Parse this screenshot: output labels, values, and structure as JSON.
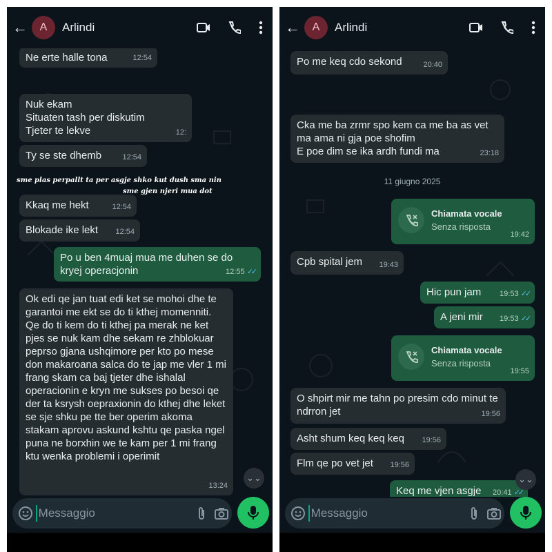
{
  "contact": {
    "initial": "A",
    "name": "Arlindi"
  },
  "composer": {
    "placeholder": "Messaggio"
  },
  "left": {
    "messages": [
      {
        "text": "Ne  erte halle tona",
        "time": "12:54"
      },
      {
        "text": "Nuk ekam\nSituaten tash per diskutim\nTjeter te lekve",
        "time": "12:"
      },
      {
        "text": "Ty se ste dhemb",
        "time": "12:54"
      },
      {
        "text": "Kkaq me hekt",
        "time": "12:54"
      },
      {
        "text": "Blokade ike lekt",
        "time": "12:54"
      },
      {
        "text": "Po u ben 4muaj mua me duhen se do kryej operacjonin",
        "time": "12:55"
      },
      {
        "text": "Ok edi qe jan tuat edi ket se mohoi dhe te garantoi me ekt se do ti kthej momenniti. Qe do ti kem do ti kthej pa merak ne ket pjes se nuk kam dhe sekam re zhblokuar peprso gjana ushqimore per kto po mese don makaroana salca do te jap me vler 1 mi frang skam ca baj tjeter dhe ishalal operacionin e kryn me sukses po besoi qe der ta ksrysh oepraxionin do kthej dhe leket se sje shku pe tte ber operim akoma stakam aprovu askund kshtu qe paska ngel puna ne borxhin we te kam per 1 mi frang ktu wenka problemi i operimit",
        "time": "13:24"
      }
    ],
    "overlay": {
      "line1": "sme plas perpallt ta per asgje shko kut dush sma nin",
      "line2": "sme gjen njeri mua dot"
    }
  },
  "right": {
    "messages": [
      {
        "text": "Po me keq cdo sekond",
        "time": "20:40"
      },
      {
        "text": "Cka me ba zrmr spo kem ca me ba as vet ma ama ni gja poe shofim\nE poe dim se ika ardh fundi ma",
        "time": "23:18"
      },
      {
        "text": "Chiamata vocale",
        "sub": "Senza risposta",
        "time": "19:42"
      },
      {
        "text": "Cpb spital jem",
        "time": "19:43"
      },
      {
        "text": "Hic pun jam",
        "time": "19:53"
      },
      {
        "text": "A jeni mir",
        "time": "19:53"
      },
      {
        "text": "Chiamata vocale",
        "sub": "Senza risposta",
        "time": "19:55"
      },
      {
        "text": "O shpirt mir me tahn po presim cdo minut te ndrron jet",
        "time": "19:56"
      },
      {
        "text": "Asht shum keq keq keq",
        "time": "19:56"
      },
      {
        "text": "Flm qe po vet jet",
        "time": "19:56"
      },
      {
        "text": "Keq me vjen asgje",
        "time": "20:41"
      }
    ],
    "date": "11 giugno 2025"
  },
  "icons": {
    "back": "arrow-left-icon",
    "video": "video-camera-icon",
    "call": "phone-icon",
    "menu": "more-vertical-icon",
    "emoji": "sticker-icon",
    "attach": "paperclip-icon",
    "camera": "camera-icon",
    "mic": "microphone-icon",
    "scroll": "chevron-double-down-icon",
    "missed_call": "missed-call-icon"
  },
  "colors": {
    "background": "#0b141a",
    "incoming": "#262d31",
    "outgoing": "#1f5c3f",
    "accent": "#21c063",
    "read_ticks": "#53bdeb"
  }
}
